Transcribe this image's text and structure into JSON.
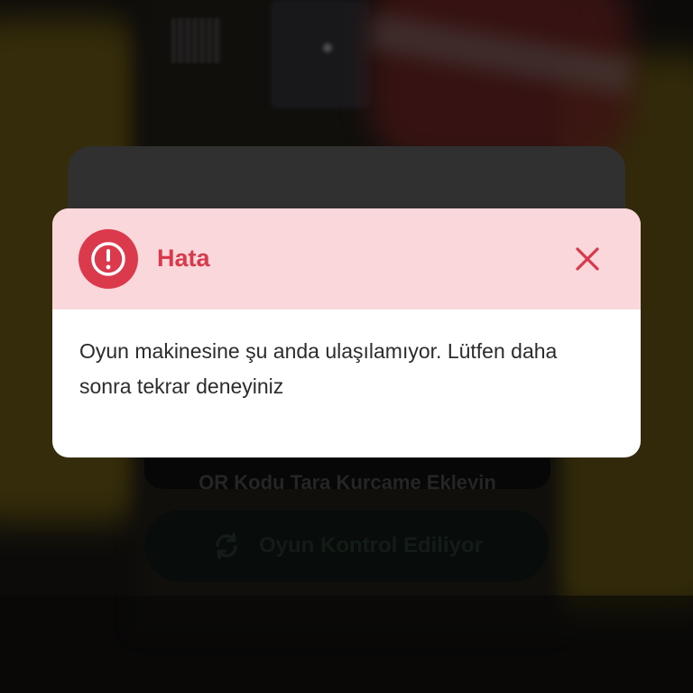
{
  "background": {
    "qr_button_label": "QR Kodu Tara Kurcame Ekleyin",
    "check_button_label": "Oyun Kontrol Ediliyor"
  },
  "dialog": {
    "title": "Hata",
    "message": "Oyun makinesine şu anda ulaşılamıyor. Lütfen daha sonra tekrar deneyiniz",
    "icons": {
      "status": "error-exclamation-icon",
      "close": "close-icon",
      "refresh": "refresh-icon"
    }
  },
  "colors": {
    "header_bg": "#f9d7da",
    "accent_red": "#db3a4c",
    "title_red": "#d8394b",
    "body_text": "#2c2c2c"
  }
}
